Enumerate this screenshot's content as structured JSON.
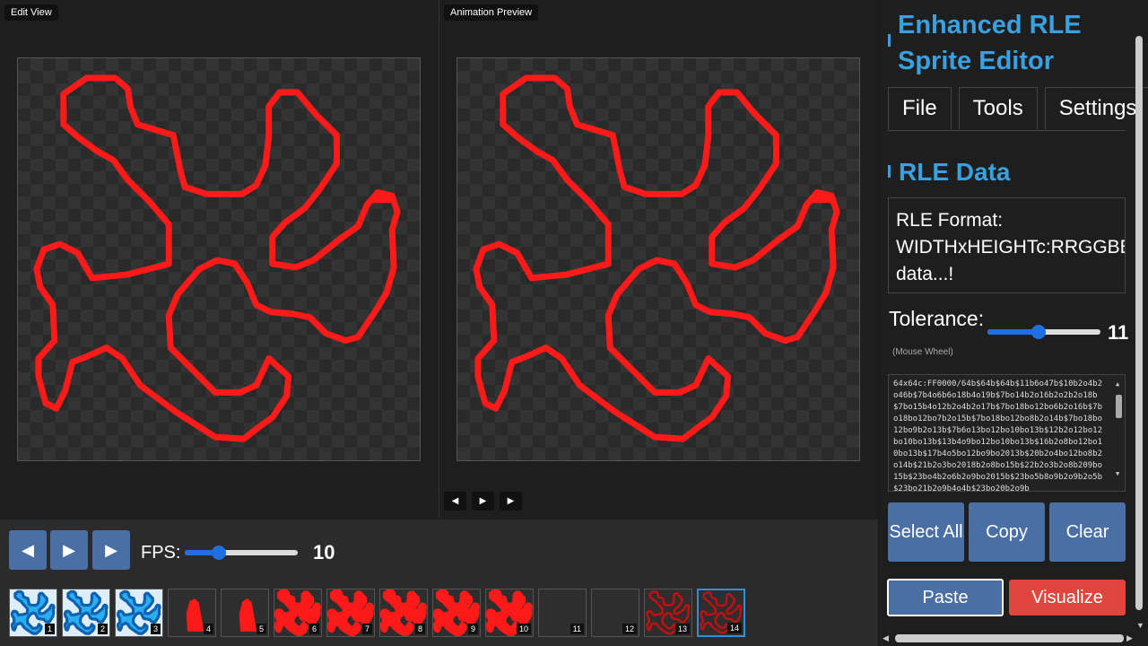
{
  "panes": {
    "edit_label": "Edit View",
    "anim_label": "Animation Preview"
  },
  "sprite": {
    "color": "#FF0000"
  },
  "playback": {
    "prev_icon": "prev-frame-icon",
    "play_icon": "play-icon",
    "next_icon": "next-frame-icon",
    "fps_label": "FPS:",
    "fps_value": "10",
    "fps_fraction": 0.3
  },
  "frames": [
    {
      "num": "1",
      "style": "blue"
    },
    {
      "num": "2",
      "style": "blue"
    },
    {
      "num": "3",
      "style": "blue"
    },
    {
      "num": "4",
      "style": "blob"
    },
    {
      "num": "5",
      "style": "blob"
    },
    {
      "num": "6",
      "style": "red"
    },
    {
      "num": "7",
      "style": "red"
    },
    {
      "num": "8",
      "style": "red"
    },
    {
      "num": "9",
      "style": "red"
    },
    {
      "num": "10",
      "style": "red"
    },
    {
      "num": "11",
      "style": "empty"
    },
    {
      "num": "12",
      "style": "empty"
    },
    {
      "num": "13",
      "style": "outline"
    },
    {
      "num": "14",
      "style": "outline"
    }
  ],
  "sidebar": {
    "app_title": "Enhanced RLE Sprite Editor",
    "tabs": [
      "File",
      "Tools",
      "Settings"
    ],
    "section_title": "RLE Data",
    "rle_info_line1": "RLE Format:",
    "rle_info_line2": "WIDTHxHEIGHTc:RRGGBB/...",
    "rle_info_line3": "data...!",
    "tolerance_label": "Tolerance:",
    "tolerance_value": "11",
    "tolerance_fraction": 0.45,
    "tolerance_hint": "(Mouse Wheel)",
    "rle_text": "64x64c:FF0000/64b$64b$64b$11b6o47b$10b2o4b2o46b$7b4o6b6o18b4o19b$7bo14b2o16b2o2b2o18b$7bo15b4o12b2o4b2o17b$7bo18bo12bo6b2o16b$7bo18bo12bo7b2o15b$7bo18bo12bo8b2o14b$7bo18bo12bo9b2o13b$7b6o13bo12bo10bo13b$12b2o12bo12bo10bo13b$13b4o9bo12bo10bo13b$16b2o8bo12bo10bo13b$17b4o5bo12bo9bo2013b$20b2o4bo12bo8b2o14b$21b2o3bo2018b2o8bo15b$22b2o3b2o8b209bo15b$23bo4b2o6b2o9bo2015b$23bo5b8o9b2o9b2o5b$23bo21b2o9b4o4b$23bo20b2o9b",
    "buttons": {
      "select_all": "Select All",
      "copy": "Copy",
      "clear": "Clear",
      "paste": "Paste",
      "visualize": "Visualize"
    }
  }
}
